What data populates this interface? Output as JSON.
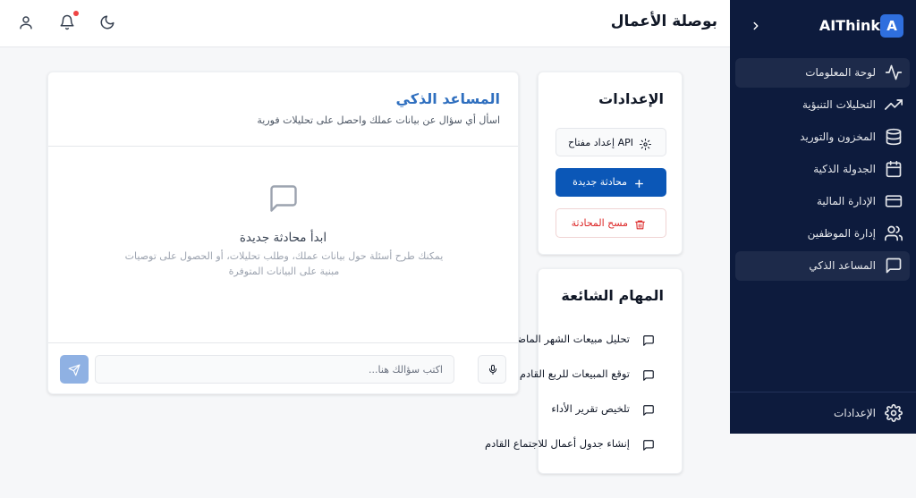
{
  "brand": {
    "badge": "A",
    "name": "AIThink"
  },
  "sidebar": {
    "items": [
      {
        "label": "لوحة المعلومات",
        "icon": "activity-icon",
        "active": true
      },
      {
        "label": "التحليلات التنبؤية",
        "icon": "trending-up-icon",
        "active": false
      },
      {
        "label": "المخزون والتوريد",
        "icon": "database-icon",
        "active": false
      },
      {
        "label": "الجدولة الذكية",
        "icon": "calendar-icon",
        "active": false
      },
      {
        "label": "الإدارة المالية",
        "icon": "credit-card-icon",
        "active": false
      },
      {
        "label": "إدارة الموظفين",
        "icon": "users-icon",
        "active": false
      },
      {
        "label": "المساعد الذكي",
        "icon": "message-square-icon",
        "active": true
      }
    ],
    "settings_label": "الإعدادات"
  },
  "header": {
    "title": "بوصلة الأعمال"
  },
  "settings_card": {
    "title": "الإعدادات",
    "api_button": "إعداد مفتاح API",
    "new_chat_button": "محادثة جديدة",
    "clear_chat_button": "مسح المحادثة"
  },
  "tasks_card": {
    "title": "المهام الشائعة",
    "tasks": [
      "تحليل مبيعات الشهر الماضي",
      "توقع المبيعات للربع القادم",
      "تلخيص تقرير الأداء",
      "إنشاء جدول أعمال للاجتماع القادم"
    ]
  },
  "chat": {
    "title": "المساعد الذكي",
    "subtitle": "اسأل أي سؤال عن بيانات عملك واحصل على تحليلات فورية",
    "empty_title": "ابدأ محادثة جديدة",
    "empty_desc": "يمكنك طرح أسئلة حول بيانات عملك، وطلب تحليلات، أو الحصول على توصيات مبنية على البيانات المتوفرة",
    "input_placeholder": "اكتب سؤالك هنا...",
    "input_value": ""
  },
  "colors": {
    "sidebar_bg": "#0d1b3d",
    "accent": "#0b57b7",
    "danger": "#dc2626",
    "notification": "#ef4444"
  }
}
